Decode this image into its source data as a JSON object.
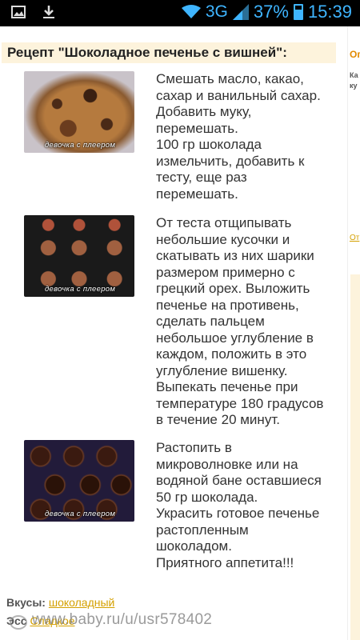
{
  "status_bar": {
    "network": "3G",
    "battery": "37%",
    "time": "15:39",
    "icons": [
      "image-icon",
      "download-icon",
      "wifi-icon",
      "signal-icon",
      "battery-icon"
    ]
  },
  "recipe": {
    "title": "Рецепт \"Шоколадное печенье с вишней\":",
    "image_caption": "девочка с плеером",
    "steps": [
      {
        "text": "Смешать масло, какао,\nсахар и ванильный сахар.\nДобавить муку,\nперемешать.\n100 гр шоколада\nизмельчить, добавить к\nтесту, еще раз\nперемешать."
      },
      {
        "text": "От теста отщипывать\nнебольшие кусочки и\nскатывать из них шарики\nразмером примерно с\nгрецкий орех. Выложить\nпеченье на противень,\nсделать пальцем\nнебольшое углубление в\nкаждом, положить в это\nуглубление вишенку.\nВыпекать печенье при\nтемпературе 180 градусов\nв течение 20 минут."
      },
      {
        "text": "Растопить в\nмикроволновке или на\nводяной бане оставшиеся\n50 гр шоколада.\nУкрасить готовое печенье\nрастопленным\nшоколадом.\nПриятного аппетита!!!"
      }
    ]
  },
  "tags": {
    "label": "Вкусы:",
    "value": "шоколадный",
    "label2": "Эсс",
    "value2": "Сладкое"
  },
  "watermark": "www.baby.ru/u/usr578402",
  "sidebar": {
    "heading": "Oг",
    "text": "Ка\nку",
    "link": "От"
  },
  "colors": {
    "status_accent": "#3fb5ff",
    "header_bg": "#fdf3dc",
    "link": "#d4a000",
    "side_heading": "#e28a00"
  }
}
